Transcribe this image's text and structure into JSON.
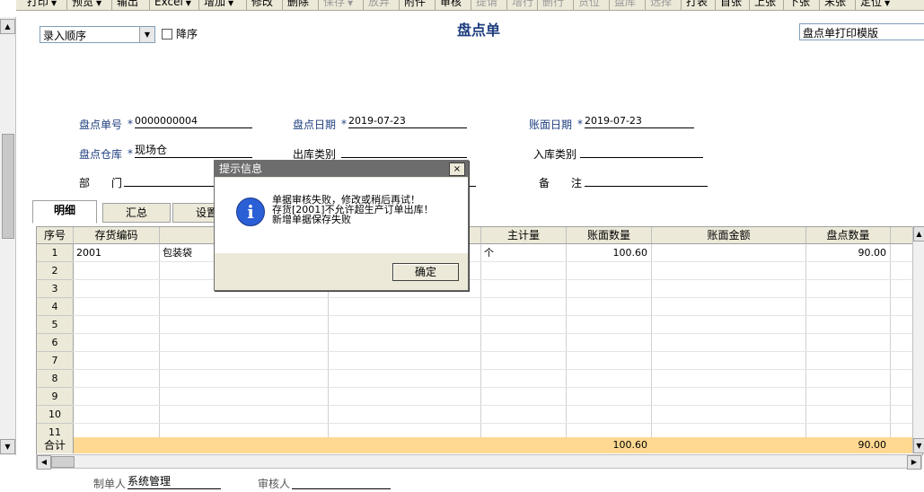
{
  "toolbar": {
    "buttons": [
      {
        "label": "打印",
        "dropdown": true,
        "enabled": true
      },
      {
        "label": "预览",
        "dropdown": true,
        "enabled": true
      },
      {
        "label": "输出",
        "dropdown": false,
        "enabled": true
      },
      {
        "label": "Excel",
        "dropdown": true,
        "enabled": true
      },
      {
        "label": "增加",
        "dropdown": true,
        "enabled": true
      },
      {
        "label": "修改",
        "dropdown": false,
        "enabled": true
      },
      {
        "label": "删除",
        "dropdown": false,
        "enabled": true
      },
      {
        "label": "保存",
        "dropdown": true,
        "enabled": false
      },
      {
        "label": "放弃",
        "dropdown": false,
        "enabled": false
      },
      {
        "label": "附件",
        "dropdown": false,
        "enabled": true
      },
      {
        "label": "审核",
        "dropdown": false,
        "enabled": true
      },
      {
        "label": "提请",
        "dropdown": false,
        "enabled": false
      },
      {
        "label": "增行",
        "dropdown": false,
        "enabled": false
      },
      {
        "label": "删行",
        "dropdown": false,
        "enabled": false
      },
      {
        "label": "货位",
        "dropdown": false,
        "enabled": false
      },
      {
        "label": "盘库",
        "dropdown": false,
        "enabled": false
      },
      {
        "label": "选择",
        "dropdown": false,
        "enabled": false
      },
      {
        "label": "打表",
        "dropdown": false,
        "enabled": true
      },
      {
        "label": "首张",
        "dropdown": false,
        "enabled": true
      },
      {
        "label": "上张",
        "dropdown": false,
        "enabled": true
      },
      {
        "label": "下张",
        "dropdown": false,
        "enabled": true
      },
      {
        "label": "末张",
        "dropdown": false,
        "enabled": true
      },
      {
        "label": "定位",
        "dropdown": true,
        "enabled": true
      }
    ]
  },
  "filter": {
    "order_value": "录入顺序",
    "descending_label": "降序",
    "descending_checked": false
  },
  "document": {
    "title": "盘点单",
    "template_value": "盘点单打印模版"
  },
  "header": {
    "doc_no_label": "盘点单号",
    "doc_no_value": "0000000004",
    "check_date_label": "盘点日期",
    "check_date_value": "2019-07-23",
    "book_date_label": "账面日期",
    "book_date_value": "2019-07-23",
    "warehouse_label": "盘点仓库",
    "warehouse_value": "现场仓",
    "out_type_label": "出库类别",
    "in_type_label": "入库类别",
    "dept_label": "部　　门",
    "remark_label": "备　　注",
    "required_mark": "*"
  },
  "tabs": [
    {
      "label": "明细",
      "active": true
    },
    {
      "label": "汇总",
      "active": false
    },
    {
      "label": "设置",
      "active": false
    }
  ],
  "grid": {
    "columns": [
      "序号",
      "存货编码",
      "",
      "",
      "主计量",
      "账面数量",
      "账面金额",
      "盘点数量"
    ],
    "row_numbers": [
      "1",
      "2",
      "3",
      "4",
      "5",
      "6",
      "7",
      "8",
      "9",
      "10",
      "11"
    ],
    "rows": [
      {
        "code": "2001",
        "name": "包装袋",
        "unit": "个",
        "book_qty": "100.60",
        "book_amount": "",
        "count_qty": "90.00"
      }
    ],
    "total_label": "合计",
    "total_book_qty": "100.60",
    "total_count_qty": "90.00"
  },
  "footer": {
    "maker_label": "制单人",
    "maker_value": "系统管理",
    "auditor_label": "审核人",
    "auditor_value": ""
  },
  "dialog": {
    "title": "提示信息",
    "close_label": "×",
    "icon_glyph": "i",
    "lines": [
      "单据审核失败，修改或稍后再试！",
      "存货[2001]不允许超生产订单出库！",
      "新增单据保存失败"
    ],
    "ok_label": "确定"
  },
  "colors": {
    "dialog_title_bar": "#6d6d6d",
    "total_row": "#ffd992",
    "label_blue": "#1f3f7f"
  }
}
